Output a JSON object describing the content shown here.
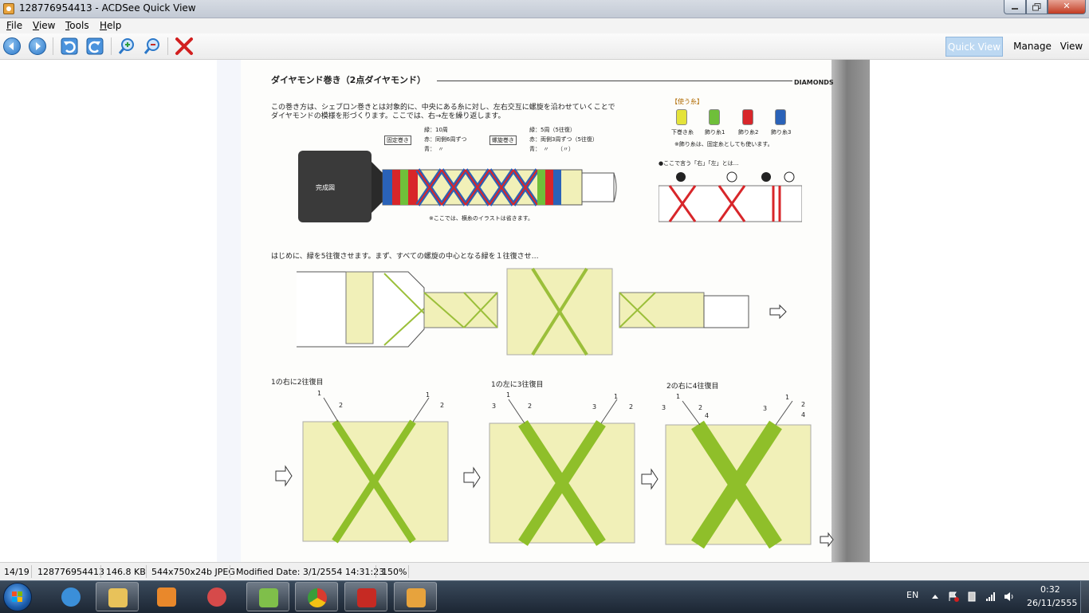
{
  "window": {
    "title": "128776954413 - ACDSee Quick View",
    "buttons": {
      "minimize": "",
      "maximize": "",
      "close": "✕"
    }
  },
  "menu": [
    {
      "label": "File"
    },
    {
      "label": "View"
    },
    {
      "label": "Tools"
    },
    {
      "label": "Help"
    }
  ],
  "toolbar": {
    "icons": [
      "previous-icon",
      "next-icon",
      "rotate-left-icon",
      "rotate-right-icon",
      "zoom-in-icon",
      "zoom-out-icon",
      "delete-icon"
    ],
    "modes": [
      {
        "label": "Quick View",
        "active": true
      },
      {
        "label": "Manage"
      },
      {
        "label": "View"
      }
    ]
  },
  "image": {
    "heading": "ダイヤモンド巻き（2点ダイヤモンド）",
    "heading_right": "DIAMONDS",
    "intro_line1": "この巻き方は、シェブロン巻きとは対象的に、中央にある糸に対し、左右交互に螺旋を沿わせていくことで",
    "intro_line2": "ダイヤモンドの模様を形づくります。ここでは、右→左を繰り返します。",
    "legend_title": "【使う糸】",
    "threads": [
      {
        "label": "下巻き糸",
        "color": "#e4e33a"
      },
      {
        "label": "飾り糸1",
        "color": "#6fbf3a"
      },
      {
        "label": "飾り糸2",
        "color": "#d8262a"
      },
      {
        "label": "飾り糸3",
        "color": "#2a62b8"
      }
    ],
    "legend_note": "※飾り糸は、固定糸としても使います。",
    "fix_label": "固定巻き",
    "fix_lines": [
      "緑：10周",
      "赤：同側6周ずつ",
      "青：　〃"
    ],
    "spiral_label": "螺旋巻き",
    "spiral_lines": [
      "緑：5周（5往復）",
      "赤：両側3周ずつ（5往復）",
      "青：　〃　　（〃）"
    ],
    "completed_label": "完成図",
    "completed_note": "※ここでは、横糸のイラストは省きます。",
    "lr_note": "●ここで言う「右」「左」とは…",
    "lr_marks": [
      "右",
      "左",
      "右",
      "左"
    ],
    "step_intro": "はじめに、緑を5往復させます。まず、すべての螺旋の中心となる緑を１往復させ…",
    "step_labels": [
      "1の右に2往復目",
      "1の左に3往復目",
      "2の右に4往復目"
    ],
    "step_numbers": [
      "1",
      "2",
      "1",
      "2",
      "3",
      "1",
      "2",
      "3",
      "1",
      "2",
      "3",
      "1",
      "2",
      "4",
      "3",
      "1",
      "2",
      "4"
    ]
  },
  "status": {
    "index": "14/19",
    "filename": "128776954413",
    "size": "146.8 KB",
    "dims": "544x750x24b JPEG",
    "modified": "Modified Date: 3/1/2554 14:31:23",
    "zoom": "150%"
  },
  "taskbar": {
    "apps": [
      {
        "name": "internet-explorer-icon",
        "color": "#3b8fd9"
      },
      {
        "name": "file-explorer-icon",
        "color": "#e8c25a",
        "active": true
      },
      {
        "name": "media-player-icon",
        "color": "#e9882b"
      },
      {
        "name": "paint-icon",
        "color": "#d64a4a"
      },
      {
        "name": "photo-viewer-icon",
        "color": "#7fbf4a"
      },
      {
        "name": "chrome-icon",
        "color": "#3a9d3a"
      },
      {
        "name": "acrobat-icon",
        "color": "#c62a23"
      },
      {
        "name": "acdsee-icon",
        "color": "#e7a33d",
        "active": true
      }
    ],
    "language": "EN",
    "time": "0:32",
    "date": "26/11/2555"
  }
}
